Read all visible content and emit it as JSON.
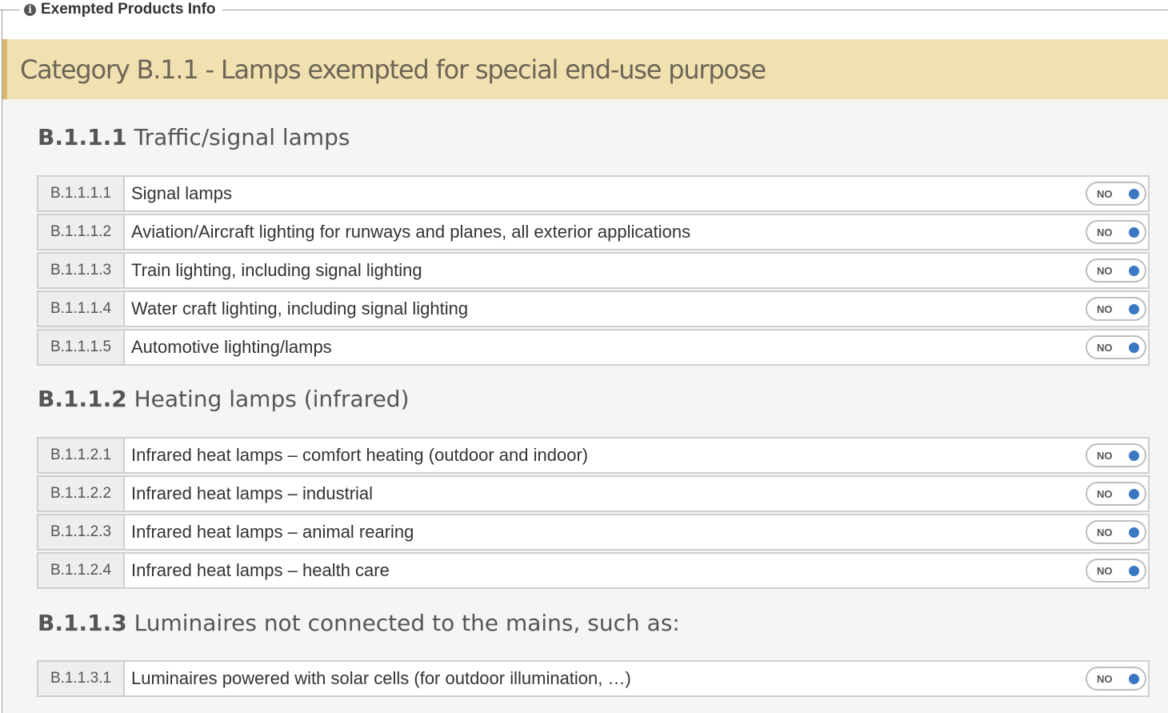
{
  "fieldset": {
    "legend": "Exempted Products Info",
    "icon": "info-circle-icon"
  },
  "category": {
    "title": "Category B.1.1 - Lamps exempted for special end-use purpose"
  },
  "sections": [
    {
      "code": "B.1.1.1",
      "title": "Traffic/signal lamps",
      "items": [
        {
          "code": "B.1.1.1.1",
          "label": "Signal lamps",
          "toggle": "NO"
        },
        {
          "code": "B.1.1.1.2",
          "label": "Aviation/Aircraft lighting for runways and planes, all exterior applications",
          "toggle": "NO"
        },
        {
          "code": "B.1.1.1.3",
          "label": "Train lighting, including signal lighting",
          "toggle": "NO"
        },
        {
          "code": "B.1.1.1.4",
          "label": "Water craft lighting, including signal lighting",
          "toggle": "NO"
        },
        {
          "code": "B.1.1.1.5",
          "label": "Automotive lighting/lamps",
          "toggle": "NO"
        }
      ]
    },
    {
      "code": "B.1.1.2",
      "title": "Heating lamps (infrared)",
      "items": [
        {
          "code": "B.1.1.2.1",
          "label": "Infrared heat lamps – comfort heating (outdoor and indoor)",
          "toggle": "NO"
        },
        {
          "code": "B.1.1.2.2",
          "label": "Infrared heat lamps – industrial",
          "toggle": "NO"
        },
        {
          "code": "B.1.1.2.3",
          "label": "Infrared heat lamps – animal rearing",
          "toggle": "NO"
        },
        {
          "code": "B.1.1.2.4",
          "label": "Infrared heat lamps – health care",
          "toggle": "NO"
        }
      ]
    },
    {
      "code": "B.1.1.3",
      "title": "Luminaires not connected to the mains, such as:",
      "items": [
        {
          "code": "B.1.1.3.1",
          "label": "Luminaires powered with solar cells (for outdoor illumination, …)",
          "toggle": "NO"
        }
      ]
    }
  ],
  "colors": {
    "banner_bg": "#f1e1b1",
    "banner_accent": "#d6b86a",
    "toggle_knob": "#3a78c2",
    "content_bg": "#f5f5f4"
  }
}
